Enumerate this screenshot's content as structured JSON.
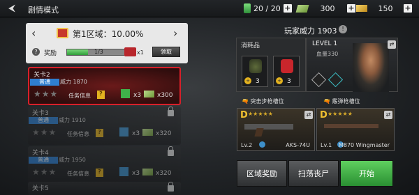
{
  "header": {
    "mode_title": "剧情模式"
  },
  "resources": {
    "energy": "20 / 20",
    "cash": "300",
    "gold": "150",
    "plus": "+"
  },
  "region": {
    "title": "第1区域：10.00%",
    "reward_label": "奖励",
    "progress_text": "1/3",
    "progress_fraction": 0.33,
    "chest_count": "x1",
    "claim_label": "领取",
    "prev": "‹",
    "next": "›"
  },
  "stages": [
    {
      "title": "关卡2",
      "difficulty": "普通",
      "power": "威力 1870",
      "task": "任务信息",
      "ammo": "x3",
      "cash": "x300",
      "locked": false
    },
    {
      "title": "关卡3",
      "difficulty": "普通",
      "power": "威力 1910",
      "task": "任务信息",
      "ammo": "x3",
      "cash": "x320",
      "locked": true
    },
    {
      "title": "关卡4",
      "difficulty": "普通",
      "power": "威力 1950",
      "task": "任务信息",
      "ammo": "x3",
      "cash": "x320",
      "locked": true
    },
    {
      "title": "关卡5",
      "difficulty": "",
      "power": "",
      "task": "",
      "ammo": "",
      "cash": "",
      "locked": true
    }
  ],
  "player": {
    "power_label": "玩家威力 1903",
    "info": "!",
    "level": "LEVEL 1",
    "hp": "血量330"
  },
  "consumables": {
    "title": "消耗品",
    "items": [
      {
        "name": "grenade",
        "count": "3"
      },
      {
        "name": "medkit",
        "count": "3"
      }
    ]
  },
  "weapons": {
    "rifle_slot_label": "突击步枪槽位",
    "shotgun_slot_label": "霰弹枪槽位",
    "rifle": {
      "grade": "D",
      "stars": "★★★★★",
      "level": "Lv.2",
      "name": "AKS-74U"
    },
    "shotgun": {
      "grade": "D",
      "stars": "★★★★★",
      "level": "Lv.1",
      "name": "M870 Wingmaster"
    }
  },
  "actions": {
    "region_reward": "区域奖励",
    "sweep": "扫荡丧尸",
    "start": "开始"
  },
  "colors": {
    "accent_red": "#d8202a",
    "start_green": "#3fb34a",
    "normal_blue": "#2f7fd0"
  }
}
